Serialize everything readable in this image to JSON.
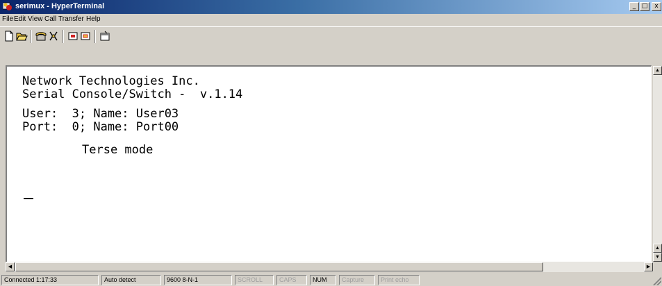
{
  "window": {
    "title": "serimux - HyperTerminal",
    "minimize_glyph": "_",
    "maximize_glyph": "□",
    "close_glyph": "x"
  },
  "menu": {
    "items": [
      "File",
      "Edit",
      "View",
      "Call",
      "Transfer",
      "Help"
    ]
  },
  "toolbar": {
    "icons": [
      "new-document-icon",
      "open-folder-icon",
      "properties-icon",
      "disconnect-icon",
      "send-file-icon",
      "receive-file-icon",
      "properties-page-icon"
    ]
  },
  "terminal": {
    "lines": [
      "Network Technologies Inc.",
      "Serial Console/Switch -  v.1.14",
      "User:  3; Name: User03",
      "Port:  0; Name: Port00",
      "Terse mode"
    ]
  },
  "statusbar": {
    "connected": "Connected 1:17:33",
    "detect": "Auto detect",
    "settings": "9600 8-N-1",
    "scroll": "SCROLL",
    "caps": "CAPS",
    "num": "NUM",
    "capture": "Capture",
    "print_echo": "Print echo"
  },
  "colors": {
    "titlebar_start": "#0a246a",
    "titlebar_end": "#a6caf0",
    "chrome": "#d4d0c8",
    "terminal_bg": "#ffffff"
  }
}
